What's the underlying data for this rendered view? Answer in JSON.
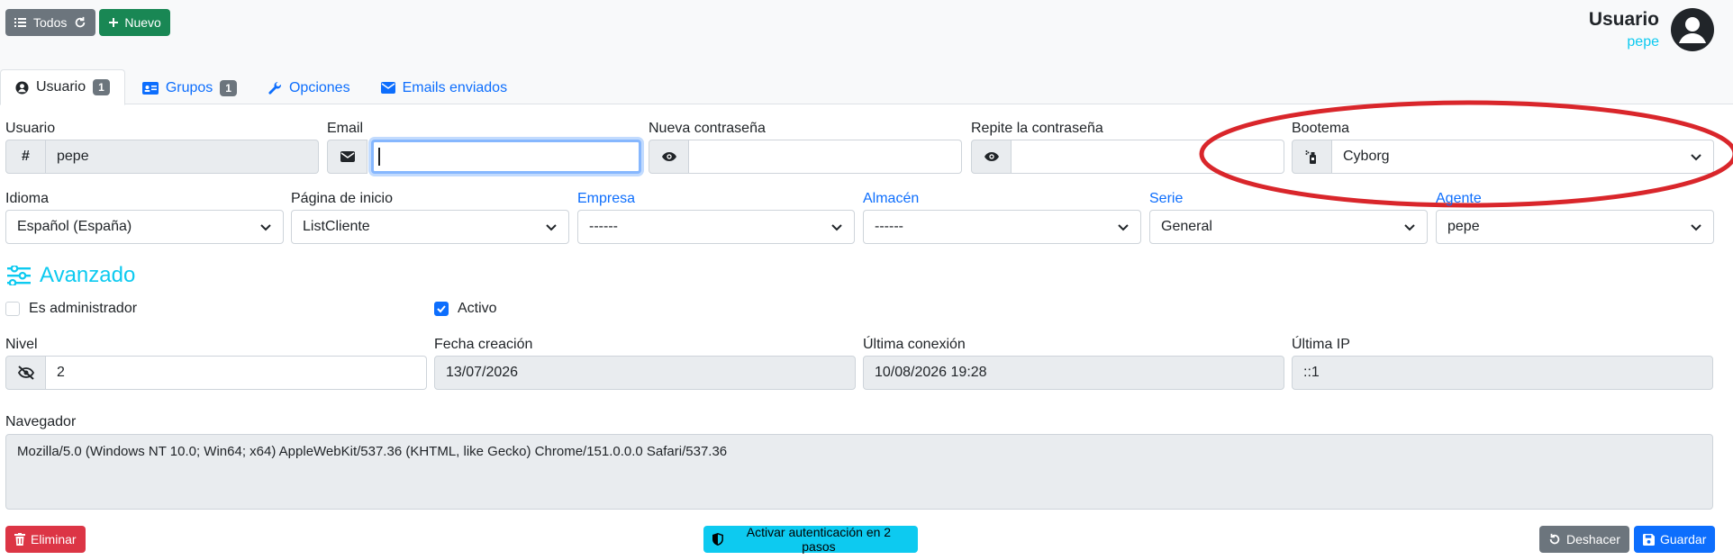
{
  "toolbar": {
    "all_label": "Todos",
    "new_label": "Nuevo"
  },
  "header": {
    "title": "Usuario",
    "subtitle": "pepe"
  },
  "tabs": [
    {
      "label": "Usuario",
      "badge": "1"
    },
    {
      "label": "Grupos",
      "badge": "1"
    },
    {
      "label": "Opciones"
    },
    {
      "label": "Emails enviados"
    }
  ],
  "form": {
    "usuario": {
      "label": "Usuario",
      "value": "pepe"
    },
    "email": {
      "label": "Email",
      "value": ""
    },
    "new_password": {
      "label": "Nueva contraseña",
      "value": ""
    },
    "repeat_password": {
      "label": "Repite la contraseña",
      "value": ""
    },
    "bootema": {
      "label": "Bootema",
      "value": "Cyborg"
    },
    "idioma": {
      "label": "Idioma",
      "value": "Español (España)"
    },
    "pagina_inicio": {
      "label": "Página de inicio",
      "value": "ListCliente"
    },
    "empresa": {
      "label": "Empresa",
      "value": "------"
    },
    "almacen": {
      "label": "Almacén",
      "value": "------"
    },
    "serie": {
      "label": "Serie",
      "value": "General"
    },
    "agente": {
      "label": "Agente",
      "value": "pepe"
    }
  },
  "advanced": {
    "title": "Avanzado",
    "is_admin_label": "Es administrador",
    "is_admin": false,
    "active_label": "Activo",
    "active": true,
    "nivel": {
      "label": "Nivel",
      "value": "2"
    },
    "fecha_creacion": {
      "label": "Fecha creación",
      "value": "13/07/2026"
    },
    "ultima_conexion": {
      "label": "Última conexión",
      "value": "10/08/2026 19:28"
    },
    "ultima_ip": {
      "label": "Última IP",
      "value": "::1"
    },
    "navegador": {
      "label": "Navegador",
      "value": "Mozilla/5.0 (Windows NT 10.0; Win64; x64) AppleWebKit/537.36 (KHTML, like Gecko) Chrome/151.0.0.0 Safari/537.36"
    }
  },
  "actions": {
    "delete_label": "Eliminar",
    "twofa_label": "Activar autenticación en 2 pasos",
    "undo_label": "Deshacer",
    "save_label": "Guardar"
  },
  "colors": {
    "primary": "#0d6efd",
    "success": "#198754",
    "danger": "#dc3545",
    "info": "#0dcaf0",
    "annotation": "#d9262b"
  },
  "icons": [
    "list-icon",
    "refresh-icon",
    "plus-icon",
    "user-circle-icon",
    "id-card-icon",
    "wrench-icon",
    "envelope-icon",
    "hash-icon",
    "eye-icon",
    "spray-icon",
    "sliders-icon",
    "eye-slash-icon",
    "trash-icon",
    "shield-icon",
    "undo-icon",
    "save-icon"
  ]
}
